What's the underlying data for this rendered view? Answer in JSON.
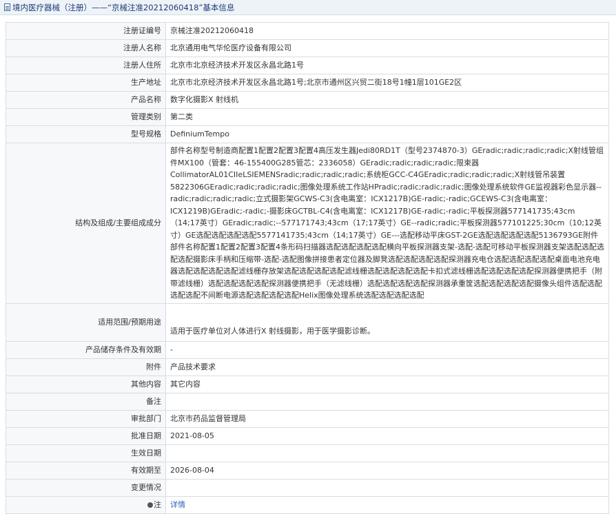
{
  "header": {
    "title": "境内医疗器械（注册）——“京械注准20212060418”基本信息"
  },
  "rows": [
    {
      "label": "注册证编号",
      "value": "京械注准20212060418"
    },
    {
      "label": "注册人名称",
      "value": "北京通用电气华伦医疗设备有限公司"
    },
    {
      "label": "注册人住所",
      "value": "北京市北京经济技术开发区永昌北路1号"
    },
    {
      "label": "生产地址",
      "value": "北京市北京经济技术开发区永昌北路1号;北京市通州区兴贸二街18号1幢1层101GE2区"
    },
    {
      "label": "产品名称",
      "value": "数字化摄影X 射线机"
    },
    {
      "label": "管理类别",
      "value": "第二类"
    },
    {
      "label": "型号规格",
      "value": "DefiniumTempo"
    },
    {
      "label": "结构及组成/主要组成成分",
      "value": "部件名称型号制造商配置1配置2配置3配置4高压发生器Jedi80RD1T（型号2374870-3）GEradic;radic;radic;radic;X射线管组件MX100（管套：46-155400G285管芯：2336058）GEradic;radic;radic;radic;限束器CollimatorAL01CIIeLSIEMENSradic;radic;radic;radic;系统柜GCC-C4GEradic;radic;radic;radic;X射线管吊装置5822306GEradic;radic;radic;radic;图像处理系统工作站HPradic;radic;radic;radic;图像处理系统软件GE监视器彩色显示器--radic;radic;radic;radic;立式摄影架GCWS-C3(含电离室：ICX1217B)GE-radic;-radic;GCEWS-C3(含电离室：ICX1219B)GEradic;-radic;-摄影床GCTBL-C4(含电离室：ICX1217B)GE-radic;-radic;平板探测器577141735;43cm（14;17英寸）GEradic;radic;--577171743;43cm（17;17英寸）GE--radic;radic;平板探测器577101225;30cm（10;12英寸）GE选配选配选配选配5577141735;43cm（14;17英寸）GE---选配移动平床GST-2GE选配选配选配选配5136793GE附件部件名称配置1配置2配置3配置4条形码扫描器选配选配选配选配横向平板探测器支架-选配-选配可移动平板探测器支架选配选配选配选配摄影床手柄和压缩带-选配-选配图像拼接患者定位器及脚凳选配选配选配选配探测器充电仓选配选配选配选配桌面电池充电器选配选配选配选配滤线栅存放架选配选配选配选配滤线栅选配选配选配选配卡扣式滤线栅选配选配选配选配探测器便携把手（附带滤线栅）选配选配选配选配探测器便携把手（无滤线栅）选配选配选配选配探测器承重筐选配选配选配选配摄像头组件选配选配选配选配不间断电源选配选配选配选配Helix图像处理系统选配选配选配选配"
    },
    {
      "label": "适用范围/预期用途",
      "value": "适用于医疗单位对人体进行X 射线摄影，用于医学摄影诊断。"
    },
    {
      "label": "产品储存条件及有效期",
      "value": "-"
    },
    {
      "label": "附件",
      "value": "产品技术要求"
    },
    {
      "label": "其他内容",
      "value": "其它内容"
    },
    {
      "label": "备注",
      "value": ""
    },
    {
      "label": "审批部门",
      "value": "北京市药品监督管理局"
    },
    {
      "label": "批准日期",
      "value": "2021-08-05"
    },
    {
      "label": "生效日期",
      "value": ""
    },
    {
      "label": "有效期至",
      "value": "2026-08-04"
    },
    {
      "label": "变更情况",
      "value": ""
    }
  ],
  "note": {
    "label": "注",
    "link_text": "详情"
  }
}
